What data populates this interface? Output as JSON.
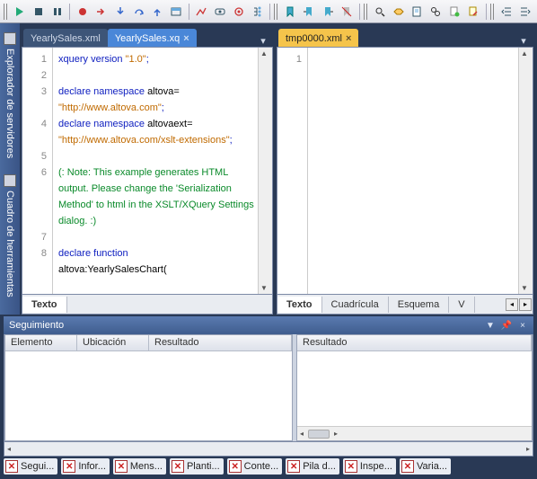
{
  "tabs_left": [
    {
      "label": "YearlySales.xml",
      "active": false
    },
    {
      "label": "YearlySales.xq",
      "active": true
    }
  ],
  "tabs_right": [
    {
      "label": "tmp0000.xml",
      "active": true
    }
  ],
  "gutter_left": [
    "1",
    "2",
    "3",
    "",
    "4",
    "",
    "5",
    "6",
    "",
    "",
    "",
    "7",
    "8",
    ""
  ],
  "gutter_right": [
    "1"
  ],
  "code_left": [
    {
      "c": "kw",
      "t": "xquery version "
    },
    {
      "c": "str",
      "t": "\"1.0\""
    },
    {
      "c": "kw",
      "t": ";"
    },
    "\n",
    "\n",
    {
      "c": "kw",
      "t": "declare namespace "
    },
    {
      "c": "fn",
      "t": "altova="
    },
    "\n",
    {
      "c": "str",
      "t": "\"http://www.altova.com\""
    },
    {
      "c": "kw",
      "t": ";"
    },
    "\n",
    {
      "c": "kw",
      "t": "declare namespace "
    },
    {
      "c": "fn",
      "t": "altovaext="
    },
    "\n",
    {
      "c": "str",
      "t": "\"http://www.altova.com/xslt-extensions\""
    },
    {
      "c": "kw",
      "t": ";"
    },
    "\n",
    "\n",
    {
      "c": "cm",
      "t": "(: Note: This example generates HTML output. Please change the 'Serialization Method' to html in the XSLT/XQuery Settings dialog. :)"
    },
    "\n",
    "\n",
    {
      "c": "kw",
      "t": "declare function"
    },
    "\n",
    {
      "c": "fn",
      "t": "altova:YearlySalesChart("
    }
  ],
  "left_bottom_tabs": [
    {
      "label": "Texto",
      "active": true
    }
  ],
  "right_bottom_tabs": [
    {
      "label": "Texto",
      "active": true
    },
    {
      "label": "Cuadrícula",
      "active": false
    },
    {
      "label": "Esquema",
      "active": false
    },
    {
      "label": "V",
      "active": false
    }
  ],
  "panel": {
    "title": "Seguimiento"
  },
  "grid_left_headers": [
    "Elemento",
    "Ubicación",
    "Resultado"
  ],
  "grid_right_headers": [
    "Resultado"
  ],
  "bottom": [
    {
      "label": "Segui..."
    },
    {
      "label": "Infor..."
    },
    {
      "label": "Mens..."
    },
    {
      "label": "Planti..."
    },
    {
      "label": "Conte..."
    },
    {
      "label": "Pila d..."
    },
    {
      "label": "Inspe..."
    },
    {
      "label": "Varia..."
    }
  ],
  "side": [
    {
      "label": "Explorador de servidores"
    },
    {
      "label": "Cuadro de herramientas"
    }
  ]
}
